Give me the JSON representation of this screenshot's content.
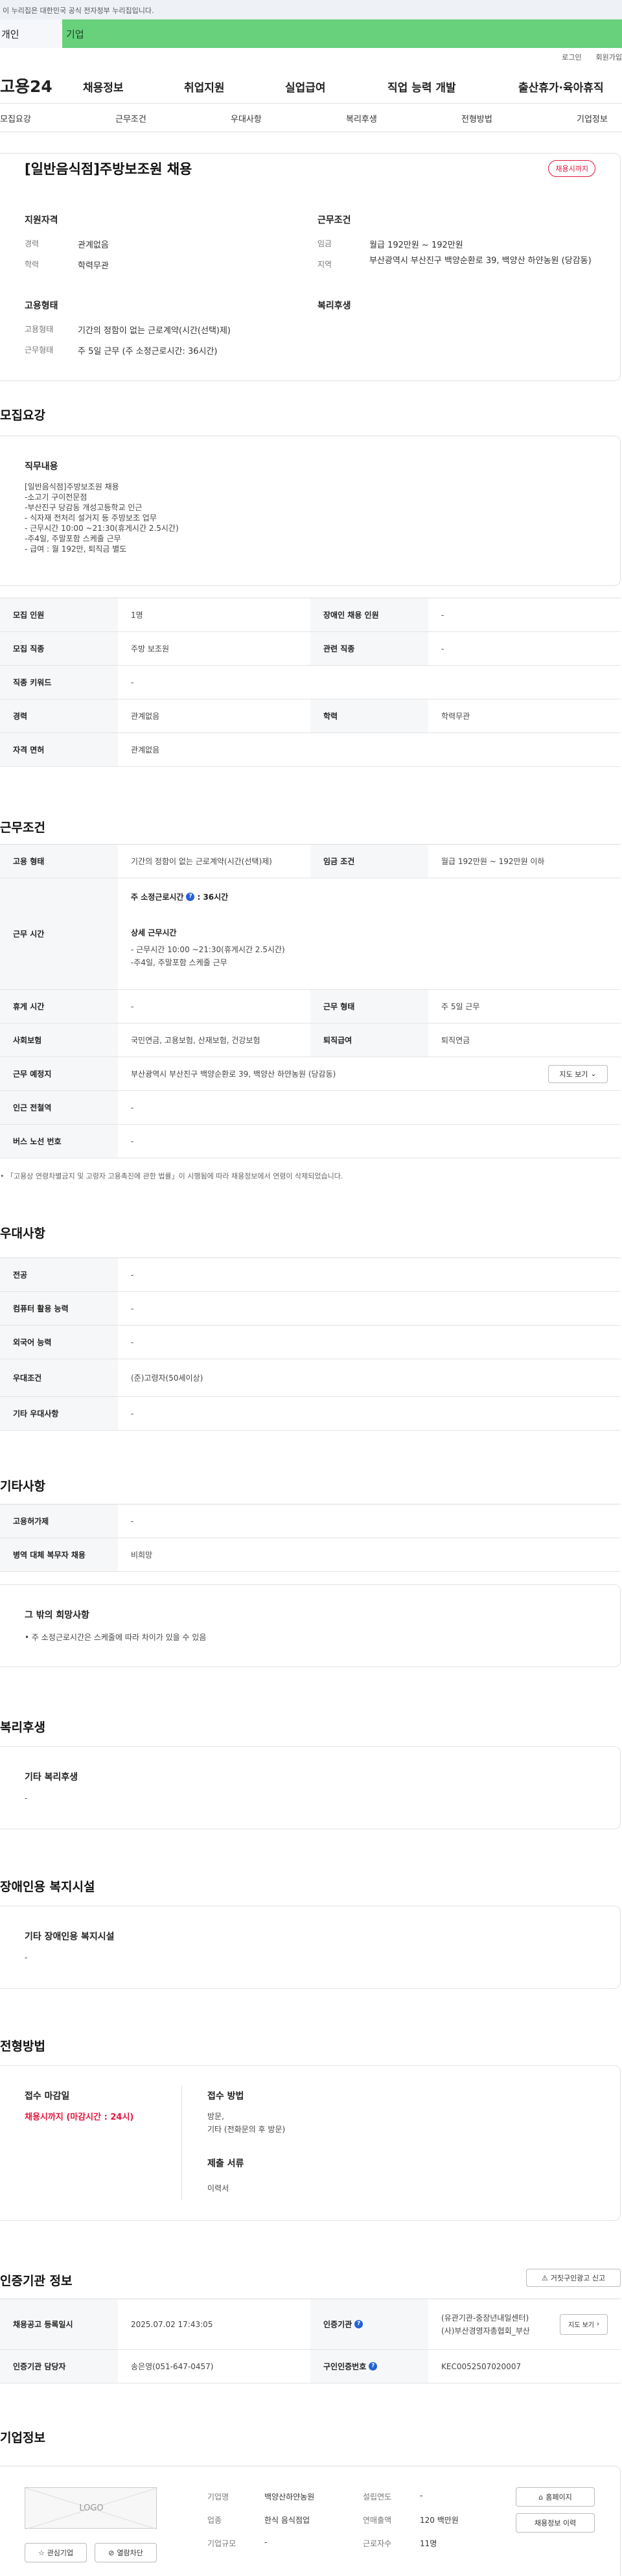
{
  "gov_banner": "이 누리집은 대한민국 공식 전자정부 누리집입니다.",
  "user_tabs": {
    "personal": "개인",
    "company": "기업"
  },
  "util": {
    "login": "로그인",
    "signup": "회원가입"
  },
  "logo": "고용24",
  "gnb": [
    "채용정보",
    "취업지원",
    "실업급여",
    "직업 능력 개발",
    "출산휴가·육아휴직"
  ],
  "anchors": [
    "모집요강",
    "근무조건",
    "우대사항",
    "복리후생",
    "전형방법",
    "기업정보"
  ],
  "summary": {
    "title": "[일반음식점]주방보조원 채용",
    "status_badge": "채용시까지",
    "qual_heading": "지원자격",
    "career_label": "경력",
    "career_value": "관계없음",
    "edu_label": "학력",
    "edu_value": "학력무관",
    "cond_heading": "근무조건",
    "wage_label": "임금",
    "wage_value": "월급 192만원 ~ 192만원",
    "region_label": "지역",
    "region_value": "부산광역시 부산진구 백양순환로 39, 백양산 하얀농원 (당감동)",
    "emp_heading": "고용형태",
    "emp_type_label": "고용형태",
    "emp_type_value": "기간의 정함이 없는 근로계약(시간(선택)제)",
    "work_form_label": "근무형태",
    "work_form_value": "주 5일 근무 (주 소정근로시간: 36시간)",
    "welfare_heading": "복리후생"
  },
  "recruit": {
    "title": "모집요강",
    "duty_heading": "직무내용",
    "duty_lines": [
      "[일반음식점]주방보조원 채용",
      "-소고기 구이전문점",
      "-부산진구 당감동 개성고등학교 인근",
      "- 식자재 전처리 설거지 등 주방보조 업무",
      "- 근무시간 10:00 ~21:30(휴게시간 2.5시간)",
      "-주4일, 주말포함 스케줄 근무",
      "- 급여 : 월 192만, 퇴직금 별도"
    ],
    "rows": [
      [
        "모집 인원",
        "1명",
        "장애인 채용 인원",
        "-"
      ],
      [
        "모집 직종",
        "주방 보조원",
        "관련 직종",
        "-"
      ],
      [
        "직종 키워드",
        "-"
      ],
      [
        "경력",
        "관계없음",
        "학력",
        "학력무관"
      ],
      [
        "자격 면허",
        "관계없음"
      ]
    ]
  },
  "work": {
    "title": "근무조건",
    "emp_type_label": "고용 형태",
    "emp_type_value": "기간의 정함이 없는 근로계약(시간(선택)제)",
    "wage_label": "임금 조건",
    "wage_value": "월급 192만원 ~ 192만원 이하",
    "hours_label": "근무 시간",
    "hours_main": "주 소정근로시간",
    "hours_main_value": ": 36시간",
    "hours_detail_heading": "상세 근무시간",
    "hours_detail_lines": [
      "- 근무시간 10:00 ~21:30(휴게시간 2.5시간)",
      "-주4일, 주말포함 스케줄 근무"
    ],
    "rest_label": "휴게 시간",
    "rest_value": "-",
    "form_label": "근무 형태",
    "form_value": "주 5일 근무",
    "ins_label": "사회보험",
    "ins_value": "국민연금, 고용보험, 산재보험, 건강보험",
    "retire_label": "퇴직급여",
    "retire_value": "퇴직연금",
    "place_label": "근무 예정지",
    "place_value": "부산광역시 부산진구 백양순환로 39, 백양산 하얀농원 (당감동)",
    "map_button": "지도 보기",
    "subway_label": "인근 전철역",
    "subway_value": "-",
    "bus_label": "버스 노선 번호",
    "bus_value": "-",
    "note": "「고용상 연령차별금지 및 고령자 고용촉진에 관한 법률」이 시행됨에 따라 채용정보에서 연령이 삭제되었습니다."
  },
  "pref": {
    "title": "우대사항",
    "rows": [
      [
        "전공",
        "-"
      ],
      [
        "컴퓨터 활용 능력",
        "-"
      ],
      [
        "외국어 능력",
        "-"
      ],
      [
        "우대조건",
        "(준)고령자(50세이상)"
      ],
      [
        "기타 우대사항",
        "-"
      ]
    ]
  },
  "etc": {
    "title": "기타사항",
    "rows": [
      [
        "고용허가제",
        "-"
      ],
      [
        "병역 대체 복무자 채용",
        "비희망"
      ]
    ],
    "box_heading": "그 밖의 희망사항",
    "box_text": "• 주 소정근로시간은 스케줄에 따라 차이가 있을 수 있음"
  },
  "welfare": {
    "title": "복리후생",
    "box_heading": "기타 복리후생",
    "box_value": "-"
  },
  "disability": {
    "title": "장애인용 복지시설",
    "box_heading": "기타 장애인용 복지시설",
    "box_value": "-"
  },
  "screening": {
    "title": "전형방법",
    "deadline_heading": "접수 마감일",
    "deadline_value": "채용시까지 (마감시간 : 24시)",
    "method_heading": "접수 방법",
    "method_lines": [
      "방문,",
      "기타 (전화문의 후 방문)"
    ],
    "docs_heading": "제출 서류",
    "docs_value": "이력서"
  },
  "cert": {
    "title": "인증기관 정보",
    "report_button": "거짓구인광고 신고",
    "reg_label": "채용공고 등록일시",
    "reg_value": "2025.07.02 17:43:05",
    "org_label": "인증기관",
    "org_lines": [
      "(유관기관-중장년내일센터)",
      "(사)부산경영자총협회_부산"
    ],
    "map_button": "지도 보기",
    "manager_label": "인증기관 담당자",
    "manager_value": "송은영(051-647-0457)",
    "offer_no_label": "구인인증번호",
    "offer_no_value": "KEC0052507020007"
  },
  "company": {
    "title": "기업정보",
    "logo_text": "LOGO",
    "name_label": "기업명",
    "name_value": "백양산하얀농원",
    "founded_label": "설립연도",
    "founded_value": "-",
    "industry_label": "업종",
    "industry_value": "한식 음식점업",
    "sales_label": "연매출액",
    "sales_value": "120 백만원",
    "size_label": "기업규모",
    "size_value": "-",
    "employees_label": "근로자수",
    "employees_value": "11명",
    "interest_button": "관심기업",
    "block_button": "열람차단",
    "homepage_button": "홈페이지",
    "history_button": "채용정보 이력"
  },
  "colors": {
    "accent_green": "#67d17c",
    "accent_red": "#e4153e",
    "primary_blue": "#2463d6"
  }
}
